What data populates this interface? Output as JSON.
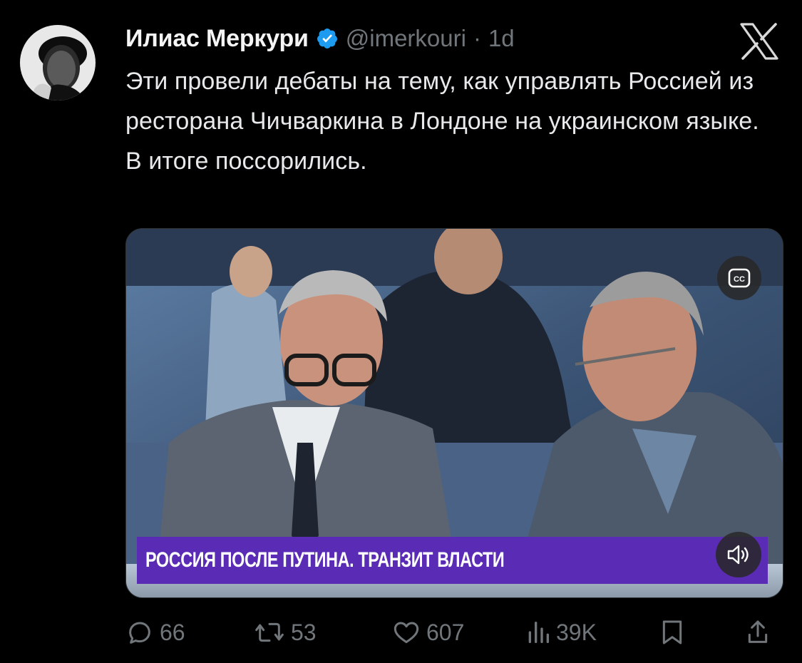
{
  "tweet": {
    "author": {
      "display_name": "Илиас Меркури",
      "handle": "@imerkouri",
      "separator": "·",
      "time": "1d",
      "verified": true
    },
    "text": "Эти провели дебаты на тему, как управлять Россией из ресторана Чичваркина в Лондоне на украинском языке. В итоге поссорились.",
    "media": {
      "type": "video",
      "lower_third": "РОССИЯ ПОСЛЕ ПУТИНА. ТРАНЗИТ ВЛАСТИ",
      "cc_icon": "cc-icon",
      "sound_icon": "speaker-icon"
    },
    "actions": {
      "replies": "66",
      "retweets": "53",
      "likes": "607",
      "views": "39K"
    }
  },
  "colors": {
    "background": "#000000",
    "text": "#e7e9ea",
    "secondary": "#71767b",
    "verified_blue": "#1d9bf0",
    "lower_third": "#5a2bb5"
  }
}
